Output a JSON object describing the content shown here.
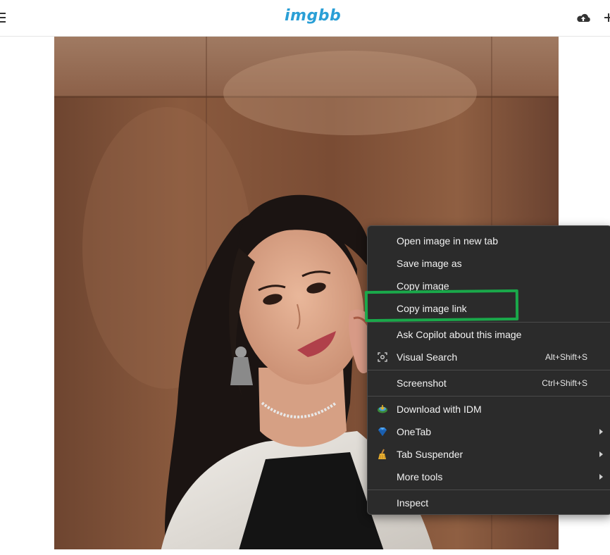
{
  "header": {
    "logo": "imgbb",
    "menu_icon": "hamburger-icon",
    "upload_icon": "cloud-upload-icon"
  },
  "colors": {
    "brand": "#2a9fd6",
    "menu_bg": "#2b2b2b",
    "highlight": "#1aa84a"
  },
  "context_menu": {
    "items": [
      {
        "label": "Open image in new tab"
      },
      {
        "label": "Save image as"
      },
      {
        "label": "Copy image"
      },
      {
        "label": "Copy image link"
      },
      {
        "label": "Ask Copilot about this image"
      },
      {
        "label": "Visual Search",
        "shortcut": "Alt+Shift+S",
        "icon": "visual-search-icon"
      },
      {
        "label": "Screenshot",
        "shortcut": "Ctrl+Shift+S"
      },
      {
        "label": "Download with IDM",
        "icon": "idm-icon"
      },
      {
        "label": "OneTab",
        "icon": "onetab-diamond-icon",
        "submenu": true
      },
      {
        "label": "Tab Suspender",
        "icon": "broom-icon",
        "submenu": true
      },
      {
        "label": "More tools",
        "submenu": true
      },
      {
        "label": "Inspect"
      }
    ]
  }
}
